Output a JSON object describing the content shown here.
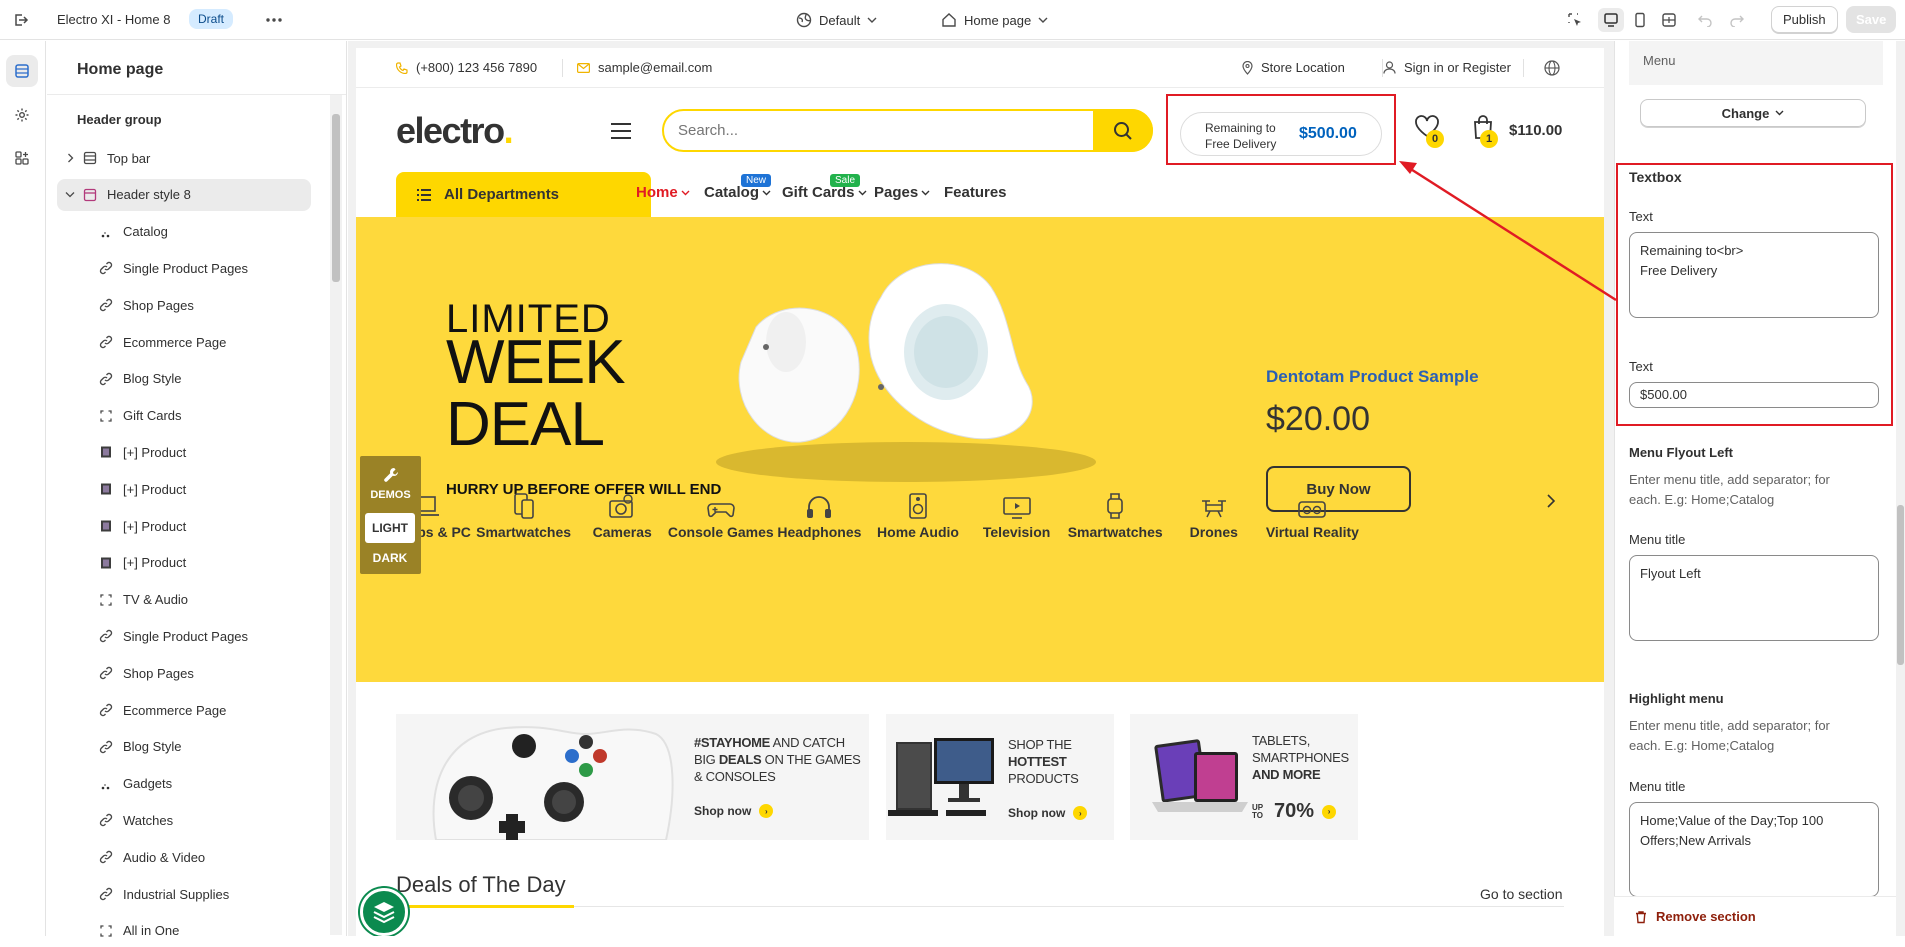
{
  "topbar": {
    "title": "Electro XI - Home 8",
    "status_badge": "Draft",
    "theme_select": "Default",
    "page_select": "Home page",
    "publish_label": "Publish",
    "save_label": "Save"
  },
  "sidebar": {
    "heading": "Home page",
    "group_label": "Header group",
    "items": [
      {
        "label": "Top bar",
        "icon": "layout-section-icon"
      },
      {
        "label": "Header style 8",
        "icon": "header-section-icon"
      },
      {
        "label": "Catalog",
        "icon": "dots-icon"
      },
      {
        "label": "Single Product Pages",
        "icon": "link-icon"
      },
      {
        "label": "Shop Pages",
        "icon": "link-icon"
      },
      {
        "label": "Ecommerce Page",
        "icon": "link-icon"
      },
      {
        "label": "Blog Style",
        "icon": "link-icon"
      },
      {
        "label": "Gift Cards",
        "icon": "block-icon"
      },
      {
        "label": "[+] Product",
        "icon": "product-thumb-icon"
      },
      {
        "label": "[+] Product",
        "icon": "product-thumb-icon"
      },
      {
        "label": "[+] Product",
        "icon": "product-thumb-icon"
      },
      {
        "label": "[+] Product",
        "icon": "product-thumb-icon"
      },
      {
        "label": "TV & Audio",
        "icon": "block-icon"
      },
      {
        "label": "Single Product Pages",
        "icon": "link-icon"
      },
      {
        "label": "Shop Pages",
        "icon": "link-icon"
      },
      {
        "label": "Ecommerce Page",
        "icon": "link-icon"
      },
      {
        "label": "Blog Style",
        "icon": "link-icon"
      },
      {
        "label": "Gadgets",
        "icon": "dots-icon"
      },
      {
        "label": "Watches",
        "icon": "link-icon"
      },
      {
        "label": "Audio & Video",
        "icon": "link-icon"
      },
      {
        "label": "Industrial Supplies",
        "icon": "link-icon"
      },
      {
        "label": "All in One",
        "icon": "block-icon"
      }
    ]
  },
  "store": {
    "phone": "(+800) 123 456 7890",
    "email": "sample@email.com",
    "store_location": "Store Location",
    "sign_in": "Sign in or Register",
    "logo_text": "electro",
    "logo_dot": ".",
    "search_placeholder": "Search...",
    "free_delivery_text": "Remaining to\nFree Delivery",
    "free_delivery_value": "$500.00",
    "wishlist_count": "0",
    "cart_count": "1",
    "cart_total": "$110.00",
    "all_departments": "All Departments",
    "nav": {
      "home": "Home",
      "catalog": "Catalog",
      "catalog_badge": "New",
      "gift_cards": "Gift Cards",
      "gift_badge": "Sale",
      "pages": "Pages",
      "features": "Features"
    },
    "accent_color": "#fed700",
    "hero": {
      "line1": "LIMITED",
      "line2": "WEEK",
      "line3": "DEAL",
      "subtitle": "HURRY UP BEFORE OFFER WILL END",
      "product_name": "Dentotam Product Sample",
      "price": "$20.00",
      "button": "Buy Now"
    },
    "demos_label": "DEMOS",
    "light_label": "LIGHT",
    "dark_label": "DARK",
    "categories": [
      {
        "label": "Laptops & PC",
        "icon": "laptop-icon"
      },
      {
        "label": "Smartwatches",
        "icon": "devices-icon"
      },
      {
        "label": "Cameras",
        "icon": "camera-icon"
      },
      {
        "label": "Console Games",
        "icon": "gamepad-icon"
      },
      {
        "label": "Headphones",
        "icon": "headphones-icon"
      },
      {
        "label": "Home Audio",
        "icon": "speaker-icon"
      },
      {
        "label": "Television",
        "icon": "tv-icon"
      },
      {
        "label": "Smartwatches",
        "icon": "watch-icon"
      },
      {
        "label": "Drones",
        "icon": "drone-icon"
      },
      {
        "label": "Virtual Reality",
        "icon": "vr-icon"
      }
    ],
    "banners": {
      "b1_l1a": "#STAYHOME",
      "b1_l1b": " AND CATCH",
      "b1_l2a": "BIG ",
      "b1_l2b": "DEALS",
      "b1_l2c": " ON THE GAMES",
      "b1_l3": "& CONSOLES",
      "b1_shop": "Shop now",
      "b2_l1": "SHOP THE",
      "b2_l2": "HOTTEST",
      "b2_l3": "PRODUCTS",
      "b2_shop": "Shop now",
      "b3_l1": "TABLETS,",
      "b3_l2": "SMARTPHONES",
      "b3_l3": "AND MORE",
      "b3_upto": "UP TO",
      "b3_pct": "70%"
    },
    "deals_title": "Deals of The Day",
    "go_to_section": "Go to section"
  },
  "right_panel": {
    "menu_label": "Menu",
    "change_button": "Change",
    "textbox_heading": "Textbox",
    "text_label_1": "Text",
    "text_value_1": "Remaining to<br>\nFree Delivery",
    "text_label_2": "Text",
    "text_value_2": "$500.00",
    "flyout_heading": "Menu Flyout Left",
    "flyout_help": "Enter menu title, add separator; for each. E.g: Home;Catalog",
    "flyout_menu_title_label": "Menu title",
    "flyout_menu_title_value": "Flyout Left",
    "highlight_heading": "Highlight menu",
    "highlight_help": "Enter menu title, add separator; for each. E.g: Home;Catalog",
    "highlight_menu_title_label": "Menu title",
    "highlight_menu_title_value": "Home;Value of the Day;Top 100 Offers;New Arrivals",
    "remove_section": "Remove section"
  }
}
